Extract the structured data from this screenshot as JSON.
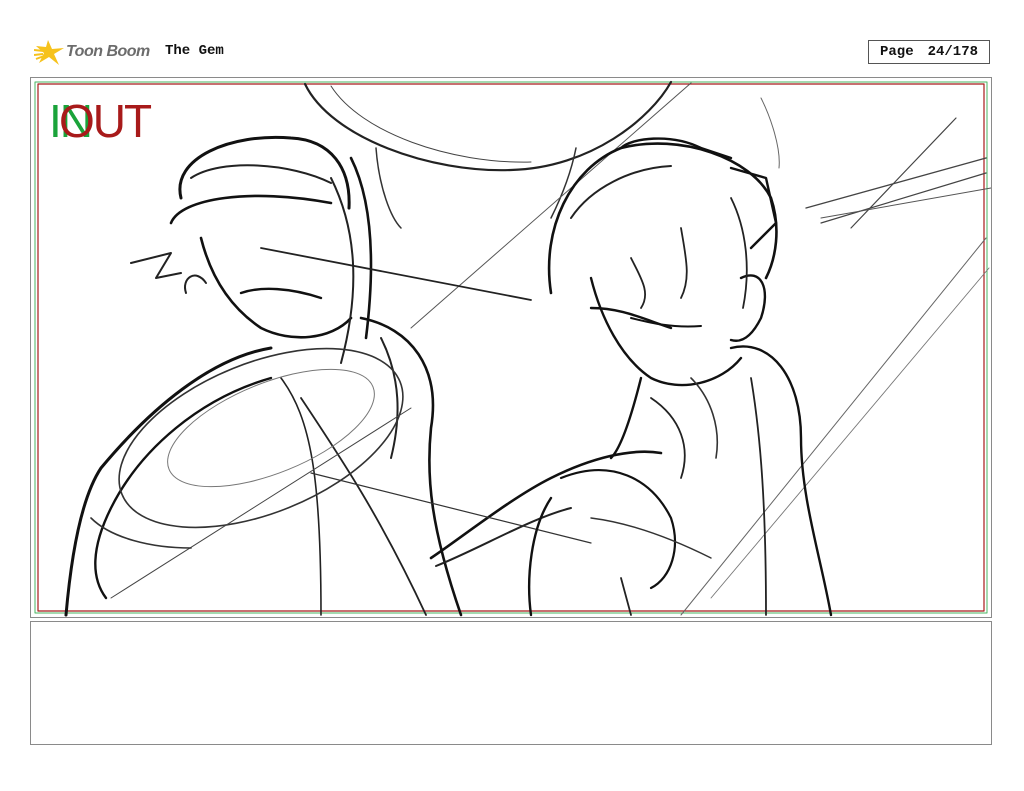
{
  "header": {
    "logo_text": "Toon Boom",
    "project_title": "The Gem",
    "page_label": "Page",
    "page_value": "24/178"
  },
  "panel": {
    "in_marker": "IN",
    "out_marker": "OUT",
    "in_color": "#1aa33a",
    "out_color": "#a81a1a",
    "artwork": "rough pencil storyboard sketch of two characters"
  },
  "notes": {
    "text": ""
  }
}
